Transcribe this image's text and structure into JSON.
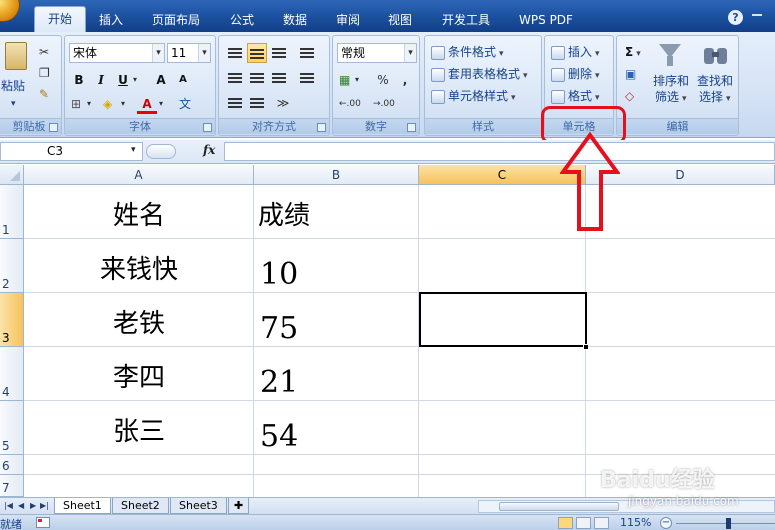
{
  "tabs": [
    "开始",
    "插入",
    "页面布局",
    "公式",
    "数据",
    "审阅",
    "视图",
    "开发工具",
    "WPS PDF"
  ],
  "active_tab": "开始",
  "groups": {
    "clipboard": {
      "paste": "粘贴",
      "label": "剪贴板"
    },
    "font": {
      "name": "宋体",
      "size": "11",
      "bold": "B",
      "italic": "I",
      "underline": "U",
      "grow": "A",
      "shrink": "A",
      "font_color": "A",
      "phonetic": "文",
      "label": "字体"
    },
    "alignment": {
      "label": "对齐方式"
    },
    "number": {
      "format": "常规",
      "percent": "%",
      "comma": ",",
      "inc_decimal": ".00",
      "dec_decimal": ".00",
      "label": "数字"
    },
    "styles": {
      "conditional": "条件格式",
      "table": "套用表格格式",
      "cell": "单元格样式",
      "label": "样式"
    },
    "cells": {
      "insert": "插入",
      "delete": "删除",
      "format": "格式",
      "label": "单元格"
    },
    "editing": {
      "sum": "Σ",
      "sort_1": "排序和",
      "sort_2": "筛选",
      "find_1": "查找和",
      "find_2": "选择",
      "label": "编辑"
    }
  },
  "formula_bar": {
    "cell_ref": "C3",
    "fx": "fx",
    "value": ""
  },
  "columns": [
    "A",
    "B",
    "C",
    "D"
  ],
  "selected_column": "C",
  "rows": [
    "1",
    "2",
    "3",
    "4",
    "5",
    "6",
    "7"
  ],
  "selected_row": "3",
  "table": {
    "header": {
      "a": "姓名",
      "b": "成绩"
    },
    "data": [
      {
        "name": "来钱快",
        "score": "10"
      },
      {
        "name": "老铁",
        "score": "75"
      },
      {
        "name": "李四",
        "score": "21"
      },
      {
        "name": "张三",
        "score": "54"
      }
    ]
  },
  "sheets": [
    "Sheet1",
    "Sheet2",
    "Sheet3"
  ],
  "active_sheet": "Sheet1",
  "status": {
    "text": "就绪",
    "zoom": "115%"
  },
  "watermark": {
    "brand": "Baidu经验",
    "url": "jingyan.baidu.com"
  },
  "colors": {
    "highlight": "#e4101e",
    "ribbon": "#d2e1f4",
    "tabbar": "#1a4f9e",
    "selected_header": "#f7c25a"
  }
}
